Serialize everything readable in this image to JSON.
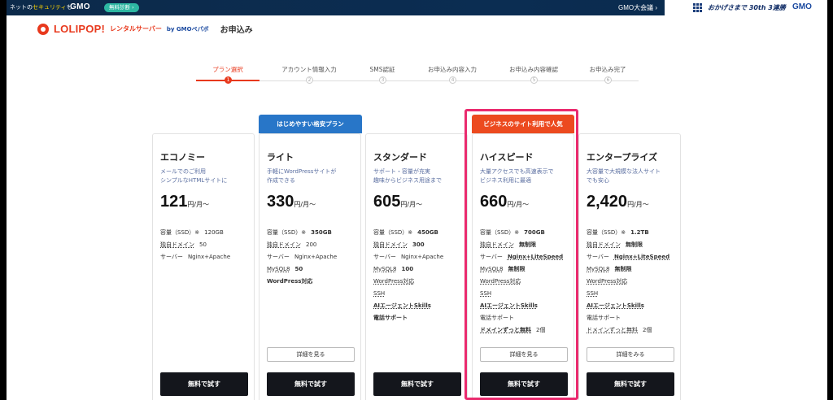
{
  "gmo_bar": {
    "security_text_prefix": "ネットの",
    "security_text_highlight": "セキュリティ",
    "security_text_suffix": "も",
    "gmo_logo": "GMO",
    "diag_pill": "無料診断 ›",
    "daikai": "GMO大会議 ›",
    "okage": "おかげさまで 30th 3連勝",
    "gmo_logo_right": "GMO"
  },
  "header": {
    "logo_text": "LOLIPOP!",
    "logo_sub": "レンタルサーバー",
    "by_text": "by GMOペパボ",
    "page_title": "お申込み"
  },
  "steps": [
    {
      "label": "プラン選択",
      "num": "1",
      "active": true
    },
    {
      "label": "アカウント情報入力",
      "num": "2",
      "active": false
    },
    {
      "label": "SMS認証",
      "num": "3",
      "active": false
    },
    {
      "label": "お申込み内容入力",
      "num": "4",
      "active": false
    },
    {
      "label": "お申込み内容確認",
      "num": "5",
      "active": false
    },
    {
      "label": "お申込み完了",
      "num": "6",
      "active": false
    }
  ],
  "plans": [
    {
      "name": "エコノミー",
      "desc": "メールでのご利用\nシンプルなHTMLサイトに",
      "price": "121",
      "unit": "円/月〜",
      "specs": [
        {
          "k": "容量（SSD）※",
          "v": "120GB",
          "u": false,
          "bold": false
        },
        {
          "k": "独自ドメイン",
          "v": "50",
          "u": true,
          "bold": false
        },
        {
          "k": "サーバー",
          "v": "Nginx+Apache",
          "u": false,
          "bold": false
        }
      ],
      "try_label": "無料で試す"
    },
    {
      "ribbon": "はじめやすい格安プラン",
      "name": "ライト",
      "desc": "手軽にWordPressサイトが\n作成できる",
      "price": "330",
      "unit": "円/月〜",
      "specs": [
        {
          "k": "容量（SSD）※",
          "v": "350GB",
          "u": false,
          "bold": true
        },
        {
          "k": "独自ドメイン",
          "v": "200",
          "u": true,
          "bold": false
        },
        {
          "k": "サーバー",
          "v": "Nginx+Apache",
          "u": false,
          "bold": false
        },
        {
          "k": "MySQL8",
          "v": "50",
          "u": true,
          "bold": true
        },
        {
          "k": "WordPress対応",
          "v": "",
          "u": false,
          "bold": true,
          "rowbold": true
        }
      ],
      "detail_label": "詳細を見る",
      "try_label": "無料で試す"
    },
    {
      "name": "スタンダード",
      "desc": "サポート・容量が充実\n趣味からビジネス用途まで",
      "price": "605",
      "unit": "円/月〜",
      "specs": [
        {
          "k": "容量（SSD）※",
          "v": "450GB",
          "u": false,
          "bold": true
        },
        {
          "k": "独自ドメイン",
          "v": "300",
          "u": true,
          "bold": true
        },
        {
          "k": "サーバー",
          "v": "Nginx+Apache",
          "u": false,
          "bold": false
        },
        {
          "k": "MySQL8",
          "v": "100",
          "u": true,
          "bold": true
        },
        {
          "k": "WordPress対応",
          "v": "",
          "u": true,
          "bold": false
        },
        {
          "k": "SSH",
          "v": "",
          "u": true,
          "bold": false
        },
        {
          "k": "AIエージェントSkills",
          "v": "",
          "u": true,
          "bold": false,
          "rowbold": true
        },
        {
          "k": "電話サポート",
          "v": "",
          "u": false,
          "bold": false,
          "rowbold": true
        }
      ],
      "try_label": "無料で試す"
    },
    {
      "ribbon": "ビジネスのサイト利用で人気",
      "name": "ハイスピード",
      "desc": "大量アクセスでも高速表示で\nビジネス利用に最適",
      "price": "660",
      "unit": "円/月〜",
      "specs": [
        {
          "k": "容量（SSD）※",
          "v": "700GB",
          "u": false,
          "bold": true
        },
        {
          "k": "独自ドメイン",
          "v": "無制限",
          "u": true,
          "bold": true
        },
        {
          "k": "サーバー",
          "v": "Nginx+LiteSpeed",
          "u": false,
          "bold": true,
          "vu": true
        },
        {
          "k": "MySQL8",
          "v": "無制限",
          "u": true,
          "bold": true
        },
        {
          "k": "WordPress対応",
          "v": "",
          "u": true,
          "bold": false
        },
        {
          "k": "SSH",
          "v": "",
          "u": true,
          "bold": false
        },
        {
          "k": "AIエージェントSkills",
          "v": "",
          "u": true,
          "bold": false,
          "rowbold": true
        },
        {
          "k": "電話サポート",
          "v": "",
          "u": false,
          "bold": false
        },
        {
          "k": "ドメインずっと無料",
          "v": "2個",
          "u": true,
          "bold": false,
          "kbold": true
        }
      ],
      "detail_label": "詳細を見る",
      "try_label": "無料で試す"
    },
    {
      "name": "エンタープライズ",
      "desc": "大容量で大規模な法人サイト\nでも安心",
      "price": "2,420",
      "unit": "円/月〜",
      "specs": [
        {
          "k": "容量（SSD）※",
          "v": "1.2TB",
          "u": false,
          "bold": true
        },
        {
          "k": "独自ドメイン",
          "v": "無制限",
          "u": true,
          "bold": true
        },
        {
          "k": "サーバー",
          "v": "Nginx+LiteSpeed",
          "u": false,
          "bold": true,
          "vu": true
        },
        {
          "k": "MySQL8",
          "v": "無制限",
          "u": true,
          "bold": true
        },
        {
          "k": "WordPress対応",
          "v": "",
          "u": true,
          "bold": false
        },
        {
          "k": "SSH",
          "v": "",
          "u": true,
          "bold": false
        },
        {
          "k": "AIエージェントSkills",
          "v": "",
          "u": true,
          "bold": false,
          "rowbold": true
        },
        {
          "k": "電話サポート",
          "v": "",
          "u": false,
          "bold": false
        },
        {
          "k": "ドメインずっと無料",
          "v": "2個",
          "u": true,
          "bold": false
        }
      ],
      "detail_label": "詳細をみる",
      "try_label": "無料で試す"
    }
  ],
  "colors": {
    "brand_red": "#e8391d",
    "ribbon_blue": "#2876c8",
    "ribbon_orange": "#ec4a1f",
    "highlight_pink": "#ea2a6e",
    "button_dark": "#14161c"
  }
}
